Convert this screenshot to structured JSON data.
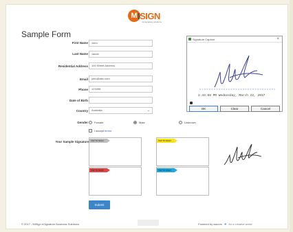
{
  "logo": {
    "mark": "M",
    "brand_a": "I",
    "brand_b": "SIGN",
    "tagline": "mi signature solutions"
  },
  "form": {
    "title": "Sample Form",
    "fields": [
      {
        "label": "First Name",
        "value": "John"
      },
      {
        "label": "Last Name",
        "value": "Jacob"
      },
      {
        "label": "Residential Address",
        "value": "100 Street Address"
      },
      {
        "label": "Email",
        "value": "john@abc.com"
      },
      {
        "label": "Phone",
        "value": "123456"
      },
      {
        "label": "Date of Birth",
        "value": ""
      }
    ],
    "country": {
      "label": "Country",
      "value": "Australia"
    },
    "gender": {
      "label": "Gender",
      "options": [
        "Female",
        "Male",
        "Unknown"
      ],
      "selected": "Male"
    },
    "terms": {
      "prefix": "I accept",
      "link": "terms"
    },
    "signatures_label": "Your Sample Signatures",
    "signature_tags": [
      {
        "text": "TAP TO SIGN",
        "color": "#bdbdbd"
      },
      {
        "text": "TAP TO SIGN",
        "color": "#f5e21b"
      },
      {
        "text": "TAP TO SIGN",
        "color": "#e04545"
      },
      {
        "text": "TAP TO SIGN",
        "color": "#1ea7e0"
      }
    ],
    "submit_label": "Submit"
  },
  "dialog": {
    "title": "Signature Capture",
    "timestamp": "2:43:58 PM Wednesday, March 22, 2017",
    "buttons": [
      "OK",
      "Clear",
      "Cancel"
    ]
  },
  "footer": {
    "copyright": "© 2017 - MiSign eSignature Business Solutions",
    "powered": "Powered by wacom",
    "slogan": "for a creative world"
  },
  "colors": {
    "accent": "#e56a16",
    "submit": "#3a86c8"
  }
}
